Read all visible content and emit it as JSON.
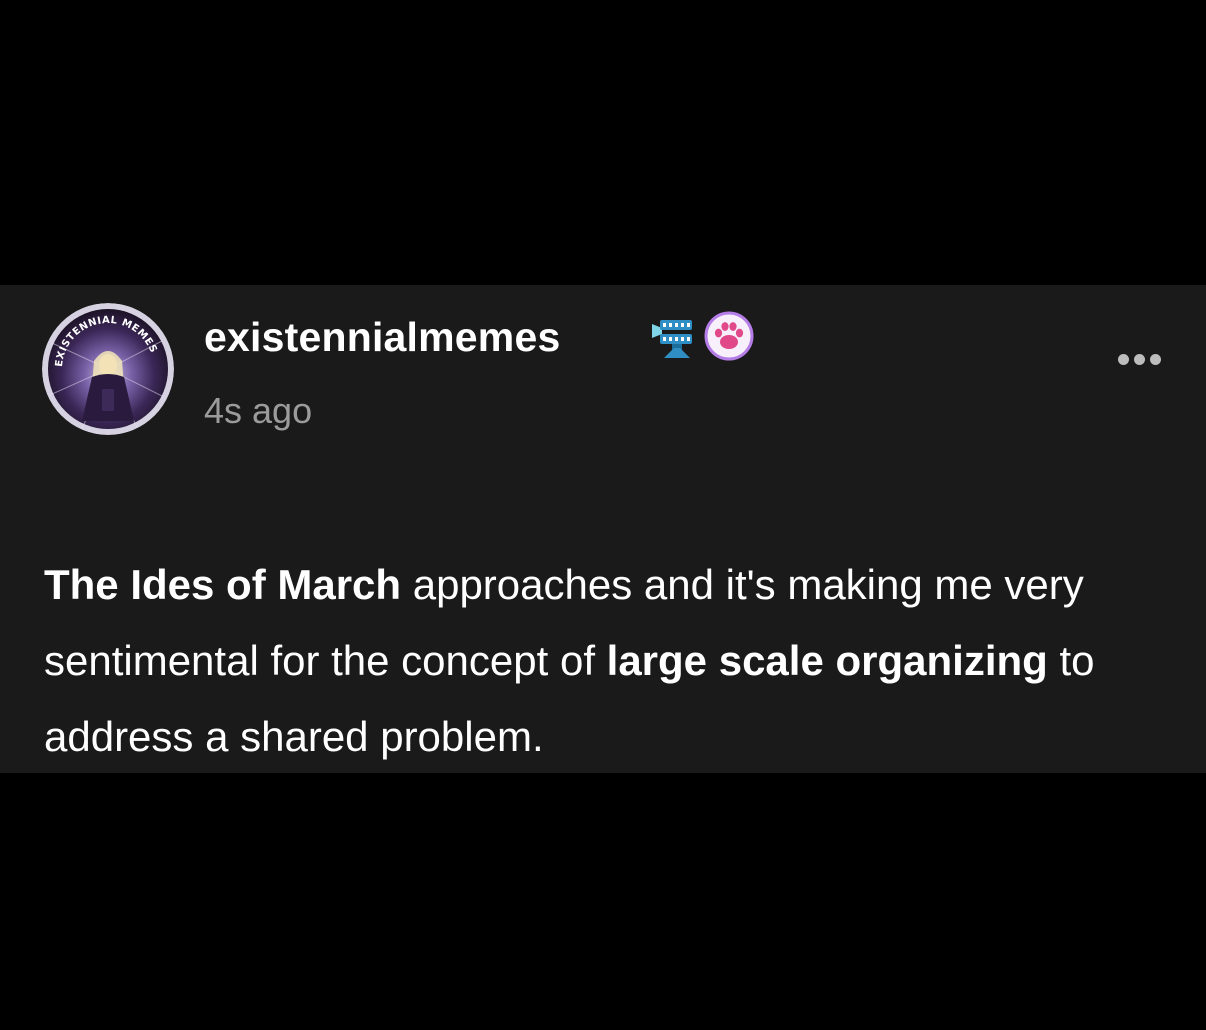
{
  "post": {
    "username": "existennialmemes",
    "timestamp": "4s ago",
    "avatar_text": "EXISTENNIAL MEMES",
    "badges": [
      "film-camera-badge-icon",
      "paw-print-badge-icon"
    ],
    "more_icon": "ellipsis-icon",
    "body_segments": [
      {
        "text": "The Ides of March",
        "bold": true
      },
      {
        "text": " approaches and it's making me very sentimental for the concept of ",
        "bold": false
      },
      {
        "text": "large scale organizing",
        "bold": true
      },
      {
        "text": " to address a shared problem.",
        "bold": false
      }
    ]
  },
  "colors": {
    "page_background": "#000000",
    "card_background": "#1a1a1a",
    "username": "#ffffff",
    "timestamp": "#9b9b9b",
    "body_text": "#ffffff",
    "badge_paw_bg": "#f7f0fb",
    "badge_paw_ring": "#b57de8",
    "badge_paw": "#e0488a"
  }
}
